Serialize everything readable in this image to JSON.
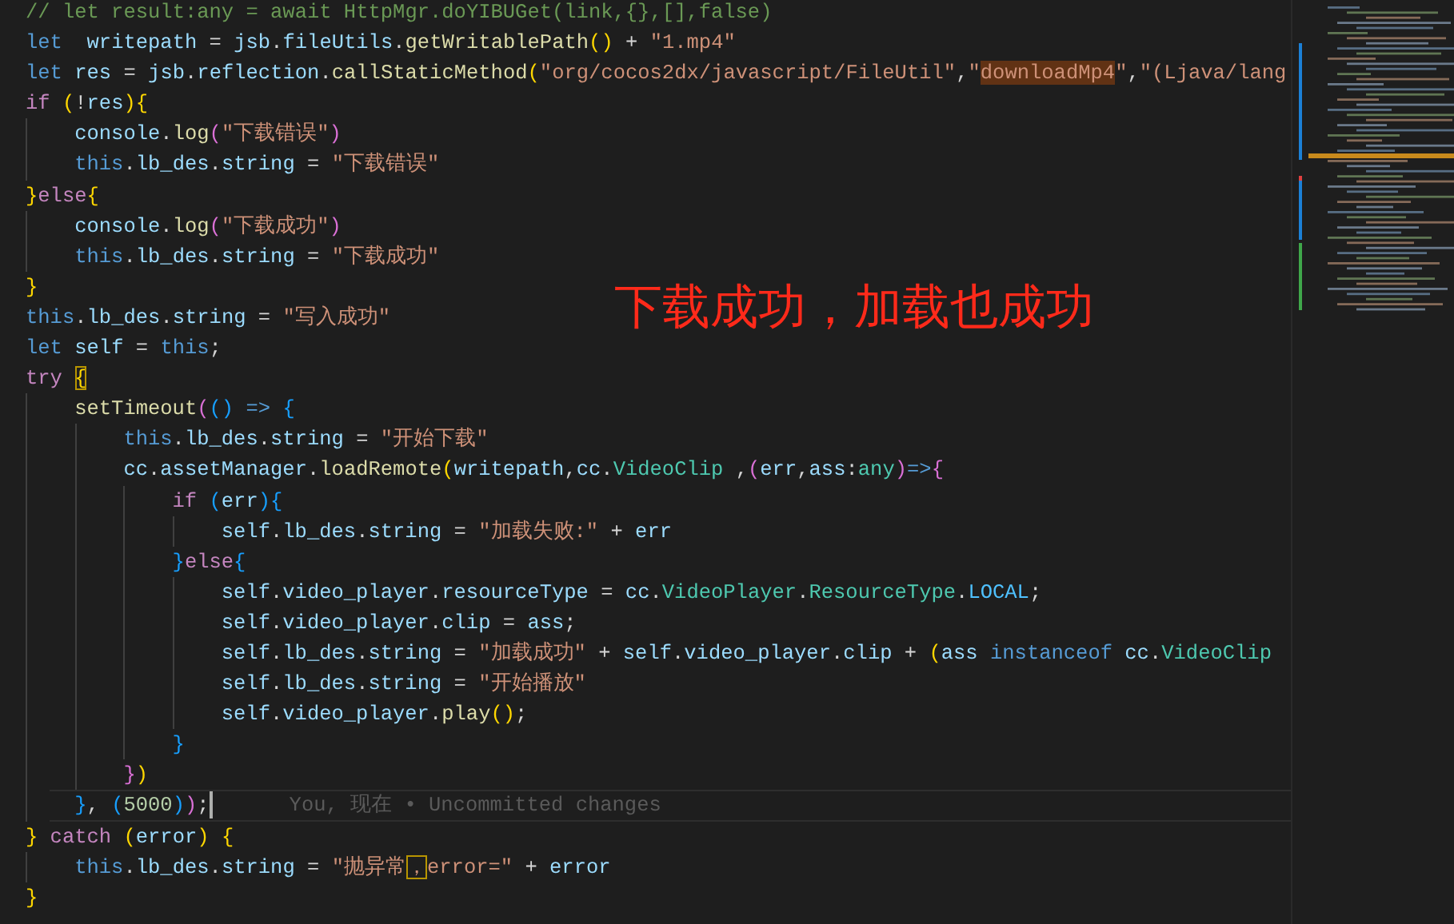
{
  "editor": {
    "lines": [
      {
        "tokens": [
          {
            "kind": "comment",
            "text": "// let result:any = await HttpMgr.doYIBUGet(link,{},[],false)"
          }
        ]
      },
      {
        "tokens": [
          {
            "kind": "keyword",
            "text": "let  "
          },
          {
            "kind": "variable",
            "text": "writepath"
          },
          {
            "kind": "plain",
            "text": " = "
          },
          {
            "kind": "variable",
            "text": "jsb"
          },
          {
            "kind": "plain",
            "text": "."
          },
          {
            "kind": "variable",
            "text": "fileUtils"
          },
          {
            "kind": "plain",
            "text": "."
          },
          {
            "kind": "function",
            "text": "getWritablePath"
          },
          {
            "kind": "bracket1",
            "text": "()"
          },
          {
            "kind": "plain",
            "text": " + "
          },
          {
            "kind": "string",
            "text": "\"1.mp4\""
          }
        ]
      },
      {
        "tokens": [
          {
            "kind": "keyword",
            "text": "let "
          },
          {
            "kind": "variable",
            "text": "res"
          },
          {
            "kind": "plain",
            "text": " = "
          },
          {
            "kind": "variable",
            "text": "jsb"
          },
          {
            "kind": "plain",
            "text": "."
          },
          {
            "kind": "variable",
            "text": "reflection"
          },
          {
            "kind": "plain",
            "text": "."
          },
          {
            "kind": "function",
            "text": "callStaticMethod"
          },
          {
            "kind": "bracket1",
            "text": "("
          },
          {
            "kind": "string",
            "text": "\"org/cocos2dx/javascript/FileUtil\""
          },
          {
            "kind": "plain",
            "text": ","
          },
          {
            "kind": "string",
            "text": "\""
          },
          {
            "kind": "string-found",
            "text": "downloadMp4"
          },
          {
            "kind": "string",
            "text": "\""
          },
          {
            "kind": "plain",
            "text": ","
          },
          {
            "kind": "string",
            "text": "\"(Ljava/lang"
          }
        ]
      },
      {
        "tokens": [
          {
            "kind": "control",
            "text": "if "
          },
          {
            "kind": "bracket1",
            "text": "("
          },
          {
            "kind": "plain",
            "text": "!"
          },
          {
            "kind": "variable",
            "text": "res"
          },
          {
            "kind": "bracket1",
            "text": "){"
          }
        ],
        "children": [
          {
            "tokens": [
              {
                "kind": "variable",
                "text": "console"
              },
              {
                "kind": "plain",
                "text": "."
              },
              {
                "kind": "function",
                "text": "log"
              },
              {
                "kind": "bracket2",
                "text": "("
              },
              {
                "kind": "string",
                "text": "\"下载错误\""
              },
              {
                "kind": "bracket2",
                "text": ")"
              }
            ]
          },
          {
            "tokens": [
              {
                "kind": "keyword",
                "text": "this"
              },
              {
                "kind": "plain",
                "text": "."
              },
              {
                "kind": "variable",
                "text": "lb_des"
              },
              {
                "kind": "plain",
                "text": "."
              },
              {
                "kind": "variable",
                "text": "string"
              },
              {
                "kind": "plain",
                "text": " = "
              },
              {
                "kind": "string",
                "text": "\"下载错误\""
              }
            ]
          }
        ]
      },
      {
        "tokens": [
          {
            "kind": "bracket1",
            "text": "}"
          },
          {
            "kind": "control",
            "text": "else"
          },
          {
            "kind": "bracket1",
            "text": "{"
          }
        ],
        "children": [
          {
            "tokens": [
              {
                "kind": "variable",
                "text": "console"
              },
              {
                "kind": "plain",
                "text": "."
              },
              {
                "kind": "function",
                "text": "log"
              },
              {
                "kind": "bracket2",
                "text": "("
              },
              {
                "kind": "string",
                "text": "\"下载成功\""
              },
              {
                "kind": "bracket2",
                "text": ")"
              }
            ]
          },
          {
            "tokens": [
              {
                "kind": "keyword",
                "text": "this"
              },
              {
                "kind": "plain",
                "text": "."
              },
              {
                "kind": "variable",
                "text": "lb_des"
              },
              {
                "kind": "plain",
                "text": "."
              },
              {
                "kind": "variable",
                "text": "string"
              },
              {
                "kind": "plain",
                "text": " = "
              },
              {
                "kind": "string",
                "text": "\"下载成功\""
              }
            ]
          }
        ]
      },
      {
        "tokens": [
          {
            "kind": "bracket1",
            "text": "}"
          }
        ]
      },
      {
        "tokens": [
          {
            "kind": "keyword",
            "text": "this"
          },
          {
            "kind": "plain",
            "text": "."
          },
          {
            "kind": "variable",
            "text": "lb_des"
          },
          {
            "kind": "plain",
            "text": "."
          },
          {
            "kind": "variable",
            "text": "string"
          },
          {
            "kind": "plain",
            "text": " = "
          },
          {
            "kind": "string",
            "text": "\"写入成功\""
          }
        ]
      },
      {
        "tokens": [
          {
            "kind": "keyword",
            "text": "let "
          },
          {
            "kind": "variable",
            "text": "self"
          },
          {
            "kind": "plain",
            "text": " = "
          },
          {
            "kind": "keyword",
            "text": "this"
          },
          {
            "kind": "plain",
            "text": ";"
          }
        ]
      },
      {
        "tokens": [
          {
            "kind": "control",
            "text": "try "
          },
          {
            "kind": "bracket1-boxed",
            "text": "{"
          }
        ],
        "children": [
          {
            "tokens": [
              {
                "kind": "function",
                "text": "setTimeout"
              },
              {
                "kind": "bracket2",
                "text": "("
              },
              {
                "kind": "bracket3",
                "text": "()"
              },
              {
                "kind": "keyword",
                "text": " => "
              },
              {
                "kind": "bracket3",
                "text": "{"
              }
            ],
            "children": [
              {
                "tokens": [
                  {
                    "kind": "keyword",
                    "text": "this"
                  },
                  {
                    "kind": "plain",
                    "text": "."
                  },
                  {
                    "kind": "variable",
                    "text": "lb_des"
                  },
                  {
                    "kind": "plain",
                    "text": "."
                  },
                  {
                    "kind": "variable",
                    "text": "string"
                  },
                  {
                    "kind": "plain",
                    "text": " = "
                  },
                  {
                    "kind": "string",
                    "text": "\"开始下载\""
                  }
                ]
              },
              {
                "tokens": [
                  {
                    "kind": "variable",
                    "text": "cc"
                  },
                  {
                    "kind": "plain",
                    "text": "."
                  },
                  {
                    "kind": "variable",
                    "text": "assetManager"
                  },
                  {
                    "kind": "plain",
                    "text": "."
                  },
                  {
                    "kind": "function",
                    "text": "loadRemote"
                  },
                  {
                    "kind": "bracket1",
                    "text": "("
                  },
                  {
                    "kind": "variable",
                    "text": "writepath"
                  },
                  {
                    "kind": "plain",
                    "text": ","
                  },
                  {
                    "kind": "variable",
                    "text": "cc"
                  },
                  {
                    "kind": "plain",
                    "text": "."
                  },
                  {
                    "kind": "type",
                    "text": "VideoClip"
                  },
                  {
                    "kind": "plain",
                    "text": " ,"
                  },
                  {
                    "kind": "bracket2",
                    "text": "("
                  },
                  {
                    "kind": "variable",
                    "text": "err"
                  },
                  {
                    "kind": "plain",
                    "text": ","
                  },
                  {
                    "kind": "variable",
                    "text": "ass"
                  },
                  {
                    "kind": "plain",
                    "text": ":"
                  },
                  {
                    "kind": "type",
                    "text": "any"
                  },
                  {
                    "kind": "bracket2",
                    "text": ")"
                  },
                  {
                    "kind": "keyword",
                    "text": "=>"
                  },
                  {
                    "kind": "bracket2",
                    "text": "{"
                  }
                ],
                "children": [
                  {
                    "tokens": [
                      {
                        "kind": "control",
                        "text": "if "
                      },
                      {
                        "kind": "bracket3",
                        "text": "("
                      },
                      {
                        "kind": "variable",
                        "text": "err"
                      },
                      {
                        "kind": "bracket3",
                        "text": "){"
                      }
                    ],
                    "children": [
                      {
                        "tokens": [
                          {
                            "kind": "variable",
                            "text": "self"
                          },
                          {
                            "kind": "plain",
                            "text": "."
                          },
                          {
                            "kind": "variable",
                            "text": "lb_des"
                          },
                          {
                            "kind": "plain",
                            "text": "."
                          },
                          {
                            "kind": "variable",
                            "text": "string"
                          },
                          {
                            "kind": "plain",
                            "text": " = "
                          },
                          {
                            "kind": "string",
                            "text": "\"加载失败:\""
                          },
                          {
                            "kind": "plain",
                            "text": " + "
                          },
                          {
                            "kind": "variable",
                            "text": "err"
                          }
                        ]
                      }
                    ]
                  },
                  {
                    "tokens": [
                      {
                        "kind": "bracket3",
                        "text": "}"
                      },
                      {
                        "kind": "control",
                        "text": "else"
                      },
                      {
                        "kind": "bracket3",
                        "text": "{"
                      }
                    ],
                    "children": [
                      {
                        "tokens": [
                          {
                            "kind": "variable",
                            "text": "self"
                          },
                          {
                            "kind": "plain",
                            "text": "."
                          },
                          {
                            "kind": "variable",
                            "text": "video_player"
                          },
                          {
                            "kind": "plain",
                            "text": "."
                          },
                          {
                            "kind": "variable",
                            "text": "resourceType"
                          },
                          {
                            "kind": "plain",
                            "text": " = "
                          },
                          {
                            "kind": "variable",
                            "text": "cc"
                          },
                          {
                            "kind": "plain",
                            "text": "."
                          },
                          {
                            "kind": "type",
                            "text": "VideoPlayer"
                          },
                          {
                            "kind": "plain",
                            "text": "."
                          },
                          {
                            "kind": "type",
                            "text": "ResourceType"
                          },
                          {
                            "kind": "plain",
                            "text": "."
                          },
                          {
                            "kind": "constant",
                            "text": "LOCAL"
                          },
                          {
                            "kind": "plain",
                            "text": ";"
                          }
                        ]
                      },
                      {
                        "tokens": [
                          {
                            "kind": "variable",
                            "text": "self"
                          },
                          {
                            "kind": "plain",
                            "text": "."
                          },
                          {
                            "kind": "variable",
                            "text": "video_player"
                          },
                          {
                            "kind": "plain",
                            "text": "."
                          },
                          {
                            "kind": "variable",
                            "text": "clip"
                          },
                          {
                            "kind": "plain",
                            "text": " = "
                          },
                          {
                            "kind": "variable",
                            "text": "ass"
                          },
                          {
                            "kind": "plain",
                            "text": ";"
                          }
                        ]
                      },
                      {
                        "tokens": [
                          {
                            "kind": "variable",
                            "text": "self"
                          },
                          {
                            "kind": "plain",
                            "text": "."
                          },
                          {
                            "kind": "variable",
                            "text": "lb_des"
                          },
                          {
                            "kind": "plain",
                            "text": "."
                          },
                          {
                            "kind": "variable",
                            "text": "string"
                          },
                          {
                            "kind": "plain",
                            "text": " = "
                          },
                          {
                            "kind": "string",
                            "text": "\"加载成功\""
                          },
                          {
                            "kind": "plain",
                            "text": " + "
                          },
                          {
                            "kind": "variable",
                            "text": "self"
                          },
                          {
                            "kind": "plain",
                            "text": "."
                          },
                          {
                            "kind": "variable",
                            "text": "video_player"
                          },
                          {
                            "kind": "plain",
                            "text": "."
                          },
                          {
                            "kind": "variable",
                            "text": "clip"
                          },
                          {
                            "kind": "plain",
                            "text": " + "
                          },
                          {
                            "kind": "bracket1",
                            "text": "("
                          },
                          {
                            "kind": "variable",
                            "text": "ass "
                          },
                          {
                            "kind": "keyword",
                            "text": "instanceof "
                          },
                          {
                            "kind": "variable",
                            "text": "cc"
                          },
                          {
                            "kind": "plain",
                            "text": "."
                          },
                          {
                            "kind": "type",
                            "text": "VideoClip"
                          }
                        ]
                      },
                      {
                        "tokens": [
                          {
                            "kind": "variable",
                            "text": "self"
                          },
                          {
                            "kind": "plain",
                            "text": "."
                          },
                          {
                            "kind": "variable",
                            "text": "lb_des"
                          },
                          {
                            "kind": "plain",
                            "text": "."
                          },
                          {
                            "kind": "variable",
                            "text": "string"
                          },
                          {
                            "kind": "plain",
                            "text": " = "
                          },
                          {
                            "kind": "string",
                            "text": "\"开始播放\""
                          }
                        ]
                      },
                      {
                        "tokens": [
                          {
                            "kind": "variable",
                            "text": "self"
                          },
                          {
                            "kind": "plain",
                            "text": "."
                          },
                          {
                            "kind": "variable",
                            "text": "video_player"
                          },
                          {
                            "kind": "plain",
                            "text": "."
                          },
                          {
                            "kind": "function",
                            "text": "play"
                          },
                          {
                            "kind": "bracket1",
                            "text": "()"
                          },
                          {
                            "kind": "plain",
                            "text": ";"
                          }
                        ]
                      }
                    ]
                  },
                  {
                    "tokens": [
                      {
                        "kind": "bracket3",
                        "text": "}"
                      }
                    ]
                  }
                ]
              },
              {
                "tokens": [
                  {
                    "kind": "bracket2",
                    "text": "}"
                  },
                  {
                    "kind": "bracket1",
                    "text": ")"
                  }
                ]
              }
            ]
          },
          {
            "tokens": [
              {
                "kind": "bracket3",
                "text": "}"
              },
              {
                "kind": "plain",
                "text": ", "
              },
              {
                "kind": "bracket3",
                "text": "("
              },
              {
                "kind": "number",
                "text": "5000"
              },
              {
                "kind": "bracket3",
                "text": ")"
              },
              {
                "kind": "bracket2",
                "text": ")"
              },
              {
                "kind": "plain",
                "text": ";"
              }
            ],
            "blame": "You, 现在 • Uncommitted changes"
          }
        ]
      },
      {
        "tokens": [
          {
            "kind": "bracket1",
            "text": "}"
          },
          {
            "kind": "control",
            "text": " catch "
          },
          {
            "kind": "bracket1",
            "text": "("
          },
          {
            "kind": "variable",
            "text": "error"
          },
          {
            "kind": "bracket1",
            "text": ") {"
          }
        ],
        "children": [
          {
            "tokens": [
              {
                "kind": "keyword",
                "text": "this"
              },
              {
                "kind": "plain",
                "text": "."
              },
              {
                "kind": "variable",
                "text": "lb_des"
              },
              {
                "kind": "plain",
                "text": "."
              },
              {
                "kind": "variable",
                "text": "string"
              },
              {
                "kind": "plain",
                "text": " = "
              },
              {
                "kind": "string",
                "text": "\"抛异常"
              },
              {
                "kind": "string-boxed",
                "text": "，"
              },
              {
                "kind": "string",
                "text": "error=\""
              },
              {
                "kind": "plain",
                "text": " + "
              },
              {
                "kind": "variable",
                "text": "error"
              }
            ]
          }
        ]
      },
      {
        "tokens": [
          {
            "kind": "bracket1",
            "text": "}"
          }
        ]
      }
    ]
  },
  "overlay_caption": "下载成功，加载也成功"
}
